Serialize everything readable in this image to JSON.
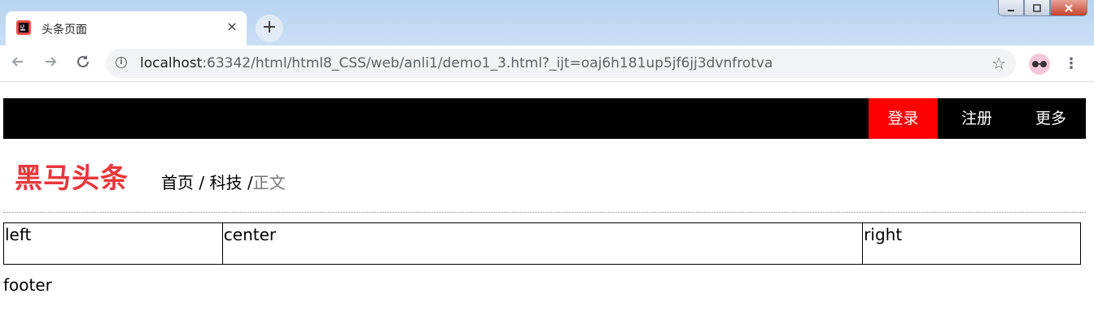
{
  "browser": {
    "tab_title": "头条页面",
    "tab_close": "×",
    "new_tab": "+",
    "url_host": "localhost",
    "url_path": ":63342/html/html8_CSS/web/anli1/demo1_3.html?_ijt=oaj6h181up5jf6jj3dvnfrotva",
    "icons": {
      "back": "back-arrow-icon",
      "forward": "forward-arrow-icon",
      "reload": "reload-icon",
      "info": "info-icon",
      "star": "star-icon",
      "menu": "kebab-menu-icon"
    }
  },
  "nav": {
    "login": "登录",
    "register": "注册",
    "more": "更多",
    "login_color": "#ff0000",
    "bar_color": "#000000"
  },
  "header": {
    "logo_text": "黑马头条",
    "logo_color": "#e9373c",
    "crumbs": {
      "home": "首页",
      "sep": "/",
      "tech": "科技",
      "current": "正文"
    }
  },
  "layout": {
    "left": "left",
    "center": "center",
    "right": "right",
    "footer": "footer"
  }
}
